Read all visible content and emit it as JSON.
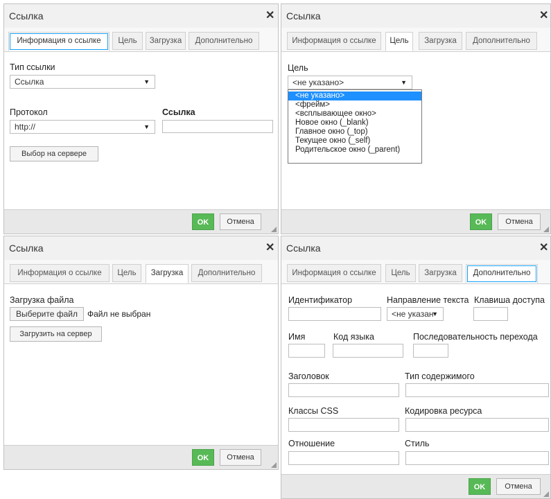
{
  "dialog_title": "Ссылка",
  "close_glyph": "✕",
  "tabs": [
    "Информация о ссылке",
    "Цель",
    "Загрузка",
    "Дополнительно"
  ],
  "ok_label": "OK",
  "cancel_label": "Отмена",
  "colors": {
    "ok": "#58b957",
    "focus": "#139ff7",
    "highlight": "#1e90ff"
  },
  "info_tab": {
    "link_type_label": "Тип ссылки",
    "link_type_value": "Ссылка",
    "protocol_label": "Протокол",
    "protocol_value": "http://",
    "url_label": "Ссылка",
    "url_value": "",
    "browse_button": "Выбор на сервере"
  },
  "target_tab": {
    "target_label": "Цель",
    "target_value": "<не указано>",
    "options": [
      "<не указано>",
      "<фрейм>",
      "<всплывающее окно>",
      "Новое окно (_blank)",
      "Главное окно (_top)",
      "Текущее окно (_self)",
      "Родительское окно (_parent)"
    ]
  },
  "upload_tab": {
    "upload_label": "Загрузка файла",
    "choose_file_button": "Выберите файл",
    "no_file_text": "Файл не выбран",
    "send_button": "Загрузить на сервер"
  },
  "advanced_tab": {
    "id_label": "Идентификатор",
    "dir_label": "Направление текста",
    "dir_value": "<не указан",
    "access_key_label": "Клавиша доступа",
    "name_label": "Имя",
    "lang_label": "Код языка",
    "tab_order_label": "Последовательность перехода",
    "title_label": "Заголовок",
    "content_type_label": "Тип содержимого",
    "css_label": "Классы CSS",
    "charset_label": "Кодировка ресурса",
    "rel_label": "Отношение",
    "style_label": "Стиль"
  }
}
